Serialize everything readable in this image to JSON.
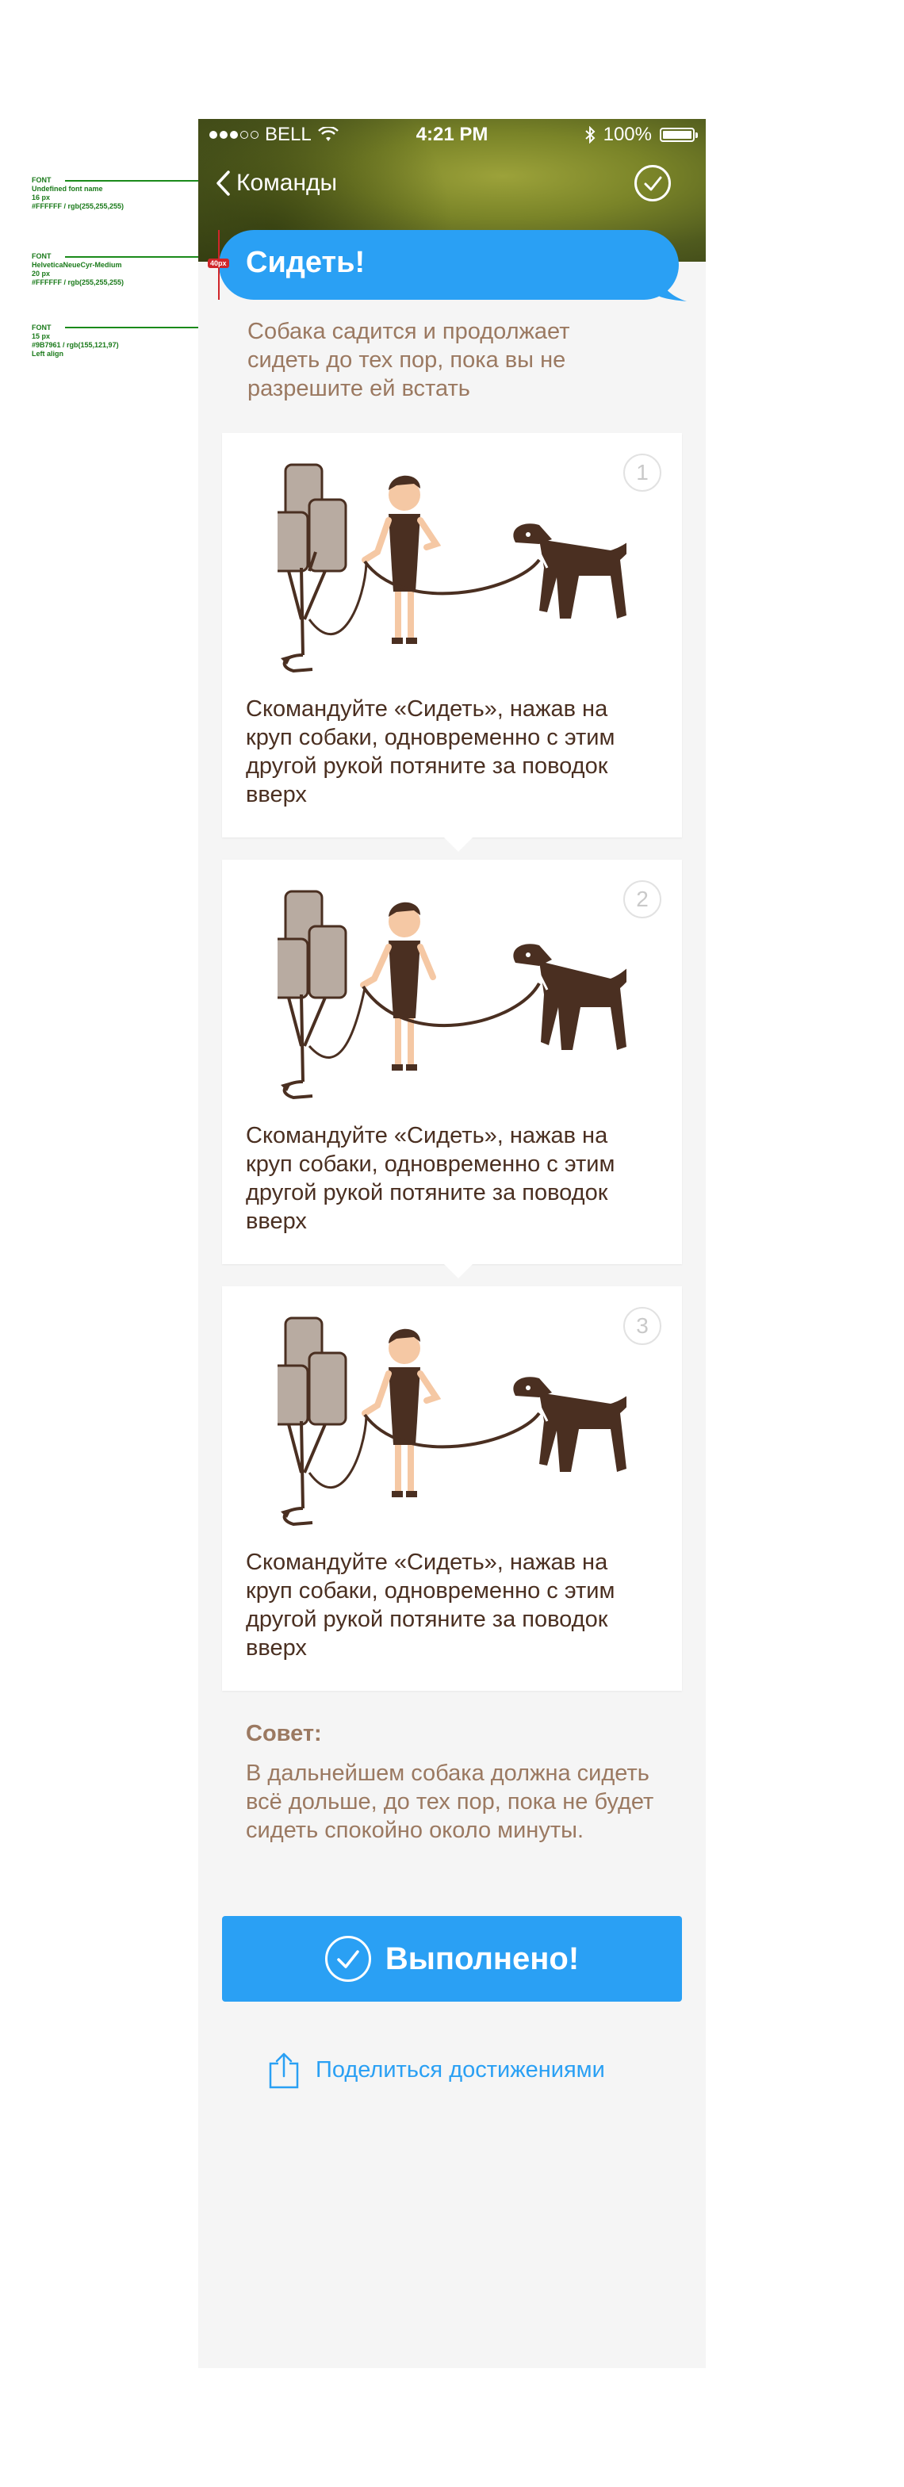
{
  "annotations": [
    {
      "lines": [
        "FONT",
        "Undefined font name",
        "16 px",
        "#FFFFFF / rgb(255,255,255)"
      ]
    },
    {
      "lines": [
        "FONT",
        "HelveticaNeueCyr-Medium",
        "20 px",
        "#FFFFFF / rgb(255,255,255)"
      ]
    },
    {
      "lines": [
        "FONT",
        "15 px",
        "#9B7961 / rgb(155,121,97)",
        "Left align"
      ]
    }
  ],
  "spacing_marker": "40px",
  "status_bar": {
    "carrier": "BELL",
    "time": "4:21 PM",
    "battery": "100%"
  },
  "nav": {
    "back_label": "Команды",
    "back_icon": "chevron-left-icon",
    "done_icon": "checkmark-circle-icon"
  },
  "title": "Сидеть!",
  "intro": "Собака садится и продолжает сидеть до тех пор, пока вы не разрешите ей встать",
  "steps": [
    {
      "number": "1",
      "text": "Скомандуйте «Сидеть», нажав на круп собаки, одновременно с этим другой рукой потяните за поводок вверх"
    },
    {
      "number": "2",
      "text": "Скомандуйте «Сидеть», нажав на круп собаки, одновременно с этим другой рукой потяните за поводок вверх"
    },
    {
      "number": "3",
      "text": "Скомандуйте «Сидеть», нажав на круп собаки, одновременно с этим другой рукой потяните за поводок вверх"
    }
  ],
  "tip": {
    "title": "Совет:",
    "text": "В дальнейшем собака должна сидеть всё дольше, до тех пор, пока не будет сидеть спокойно около минуты."
  },
  "done_button": {
    "label": "Выполнено!"
  },
  "share": {
    "label": "Поделиться достижениями",
    "icon": "share-icon"
  },
  "colors": {
    "accent": "#2AA0F4",
    "brown_text": "#4A2F21",
    "muted_text": "#9B7961",
    "background": "#F5F5F5",
    "annotation": "#1A8A1A"
  }
}
